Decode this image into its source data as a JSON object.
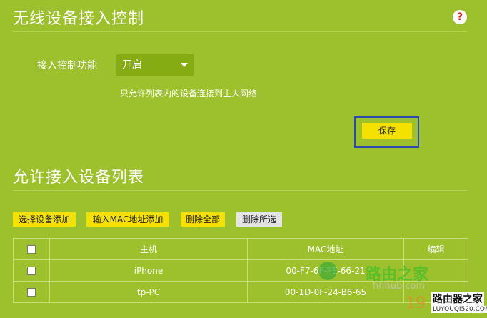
{
  "section1": {
    "title": "无线设备接入控制",
    "help_glyph": "?",
    "field_label": "接入控制功能",
    "select_value": "开启",
    "note": "只允许列表内的设备连接到主人网络",
    "save_label": "保存"
  },
  "section2": {
    "title": "允许接入设备列表",
    "buttons": {
      "select_add": "选择设备添加",
      "mac_add": "输入MAC地址添加",
      "delete_all": "删除全部",
      "delete_selected": "删除所选"
    },
    "table": {
      "headers": [
        "主机",
        "MAC地址",
        "编辑"
      ],
      "rows": [
        {
          "host": "iPhone",
          "mac": "00-F7-6F-PE-66-21"
        },
        {
          "host": "tp-PC",
          "mac": "00-1D-0F-24-B6-65"
        }
      ]
    }
  },
  "watermark": {
    "text": "路由之家",
    "partial_url": "hhhub.com",
    "partial_num": "19",
    "logo": "路由器之家",
    "logo_url": "LUYOUQI520.COM"
  },
  "colors": {
    "background": "#9dc12c",
    "button_yellow": "#f4e100",
    "highlight_border": "#2b4ab2"
  }
}
